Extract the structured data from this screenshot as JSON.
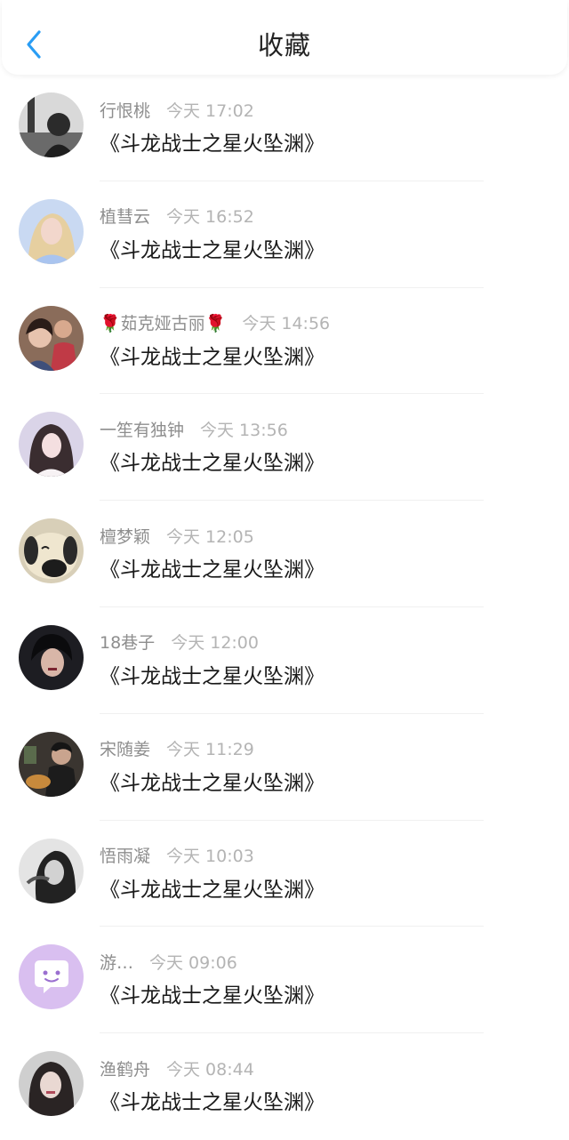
{
  "header": {
    "title": "收藏",
    "back_icon": "chevron-left-icon",
    "accent_color": "#2a9df4"
  },
  "items": [
    {
      "name": "行恨桃",
      "time": "今天 17:02",
      "post": "《斗龙战士之星火坠渊》"
    },
    {
      "name": "植彗云",
      "time": "今天 16:52",
      "post": "《斗龙战士之星火坠渊》"
    },
    {
      "name": "🌹茹克娅古丽🌹",
      "time": "今天 14:56",
      "post": "《斗龙战士之星火坠渊》"
    },
    {
      "name": "一笙有独钟",
      "time": "今天 13:56",
      "post": "《斗龙战士之星火坠渊》"
    },
    {
      "name": "檀梦颖",
      "time": "今天 12:05",
      "post": "《斗龙战士之星火坠渊》"
    },
    {
      "name": "18巷子",
      "time": "今天 12:00",
      "post": "《斗龙战士之星火坠渊》"
    },
    {
      "name": "宋随姜",
      "time": "今天 11:29",
      "post": "《斗龙战士之星火坠渊》"
    },
    {
      "name": "悟雨凝",
      "time": "今天 10:03",
      "post": "《斗龙战士之星火坠渊》"
    },
    {
      "name": "游…",
      "time": "今天 09:06",
      "post": "《斗龙战士之星火坠渊》"
    },
    {
      "name": "渔鹤舟",
      "time": "今天 08:44",
      "post": "《斗龙战士之星火坠渊》"
    }
  ]
}
